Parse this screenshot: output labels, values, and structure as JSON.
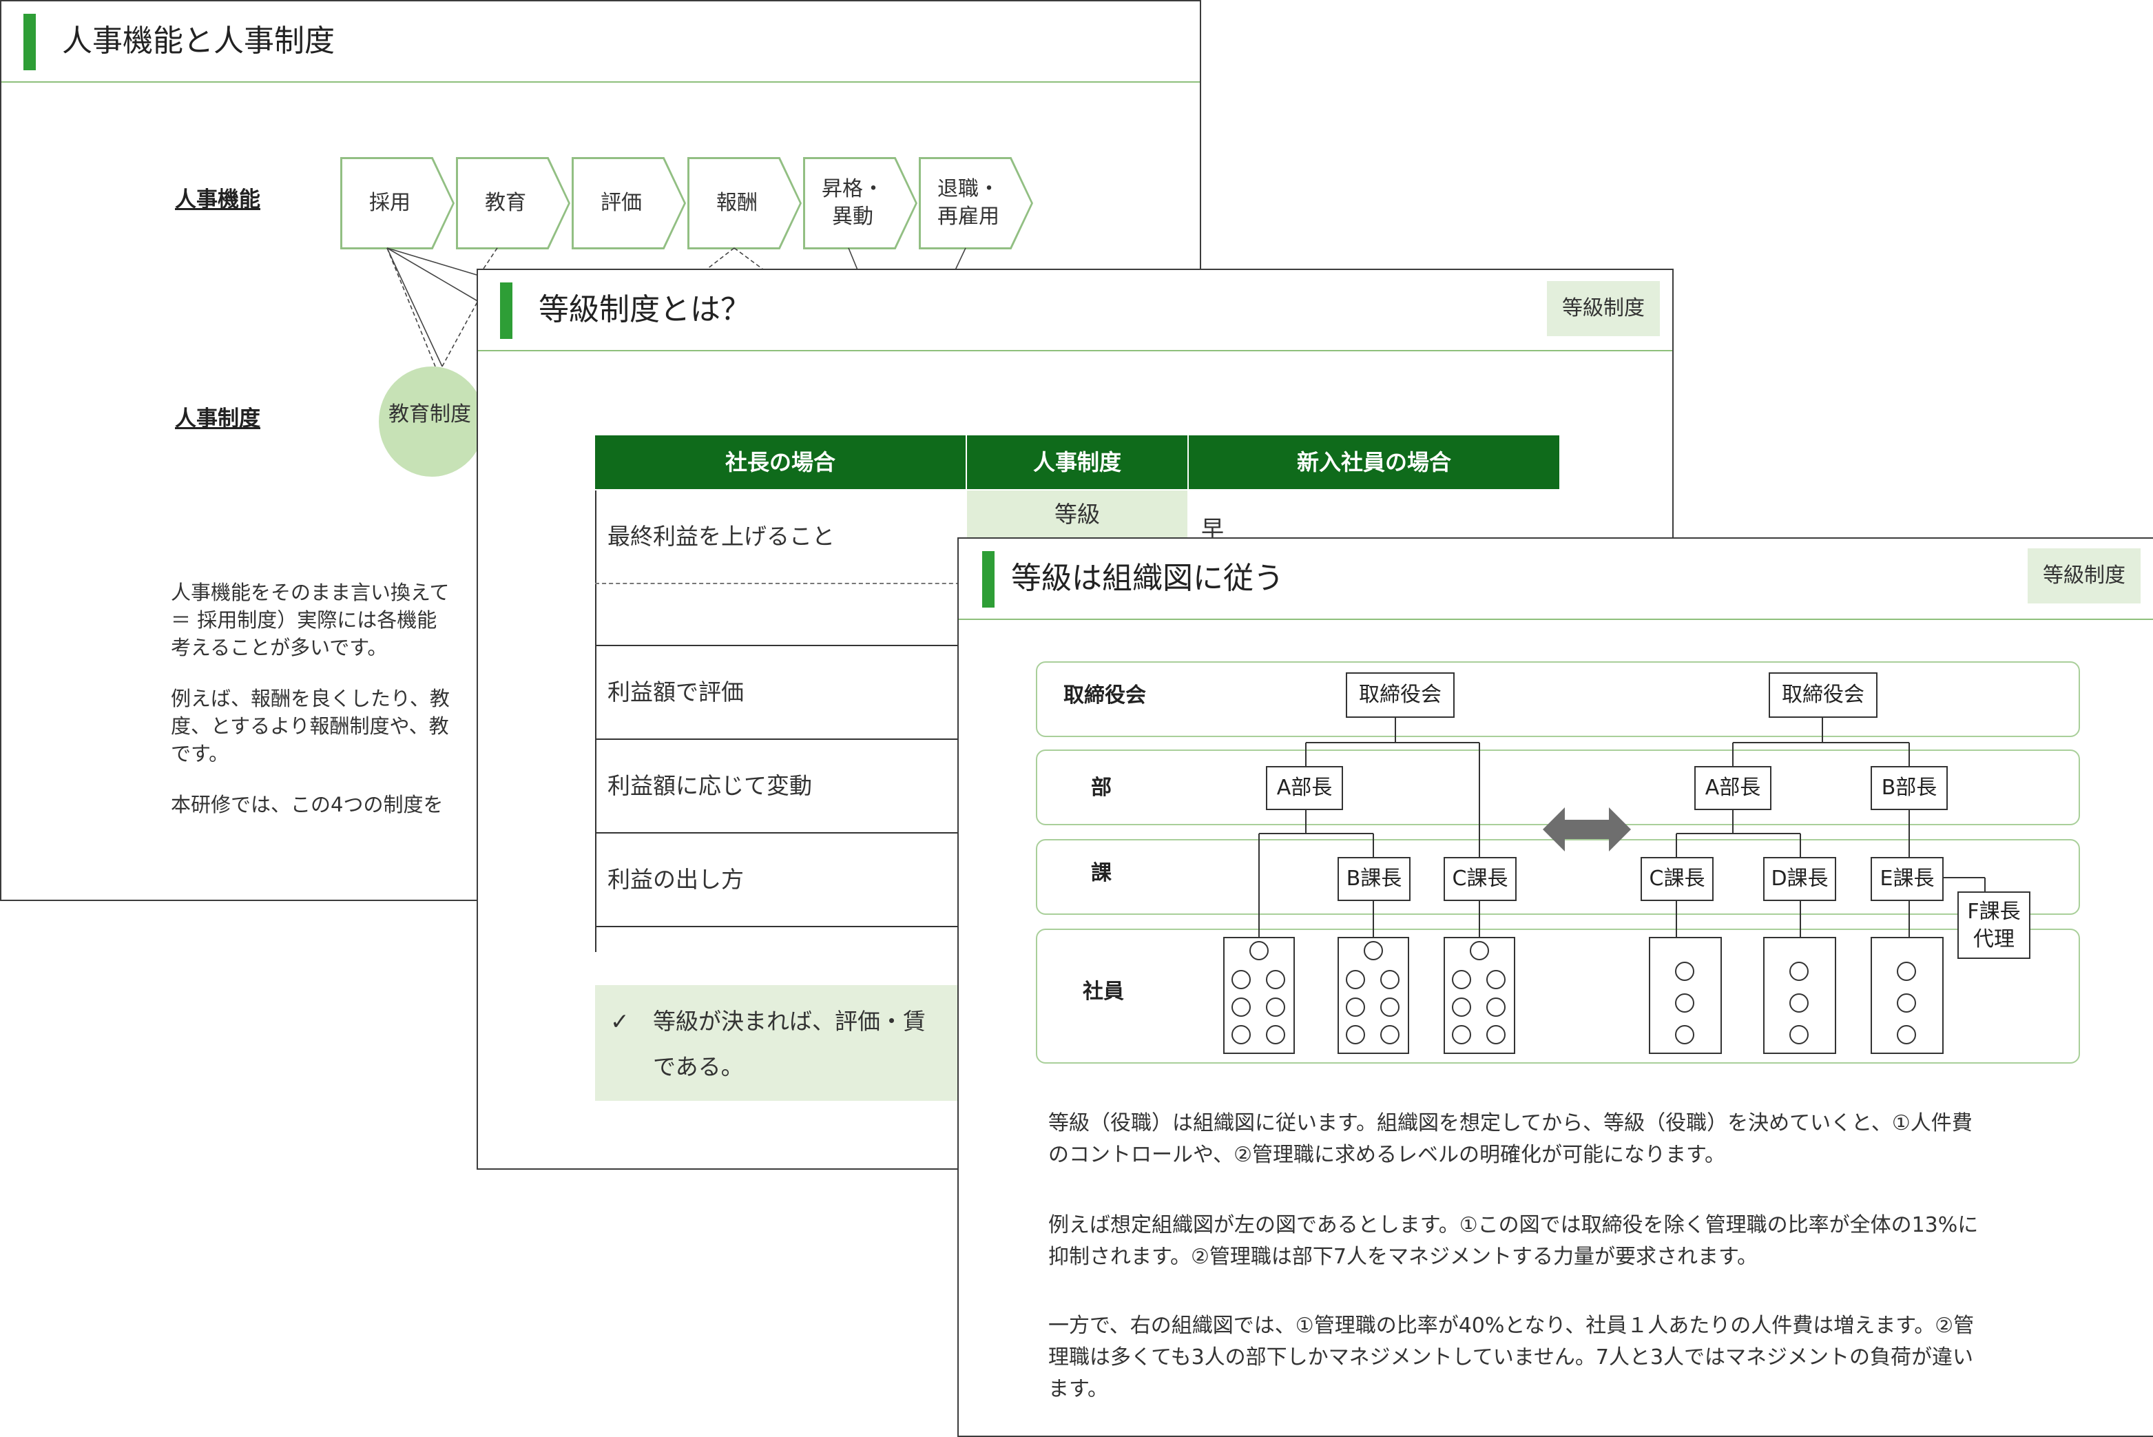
{
  "slide1": {
    "title": "人事機能と人事制度",
    "row_functions": "人事機能",
    "row_systems": "人事制度",
    "functions": [
      "採用",
      "教育",
      "評価",
      "報酬",
      "昇格・\n異動",
      "退職・\n再雇用"
    ],
    "system_circle": "教育制度",
    "para1": "人事機能をそのまま言い換えて\n＝ 採用制度）実際には各機能\n考えることが多いです。",
    "para2": "例えば、報酬を良くしたり、教\n度、とするより報酬制度や、教\nです。",
    "para3": "本研修では、この4つの制度を"
  },
  "slide2": {
    "title": "等級制度とは？",
    "tag": "等級制度",
    "headers": [
      "社長の場合",
      "人事制度",
      "新入社員の場合"
    ],
    "rows": [
      "最終利益を上げること",
      "",
      "利益額で評価",
      "利益額に応じて変動",
      "利益の出し方"
    ],
    "mid_cell": "等級",
    "right_cell": "早く業務を覚えること",
    "check": "✓",
    "callout_line1": "等級が決まれば、評価・賃",
    "callout_line2": "である。"
  },
  "slide3": {
    "title": "等級は組織図に従う",
    "tag": "等級制度",
    "lanes": [
      "取締役会",
      "部",
      "課",
      "社員"
    ],
    "left_chart": {
      "board": "取締役会",
      "dept": "A部長",
      "sections": [
        "B課長",
        "C課長"
      ]
    },
    "right_chart": {
      "board": "取締役会",
      "depts": [
        "A部長",
        "B部長"
      ],
      "sections": [
        "C課長",
        "D課長",
        "E課長"
      ],
      "deputy": "F課長\n代理"
    },
    "para1": "等級（役職）は組織図に従います。組織図を想定してから、等級（役職）を決めていくと、①人件費\nのコントロールや、②管理職に求めるレベルの明確化が可能になります。",
    "para2": "例えば想定組織図が左の図であるとします。①この図では取締役を除く管理職の比率が全体の13%に\n抑制されます。②管理職は部下7人をマネジメントする力量が要求されます。",
    "para3": "一方で、右の組織図では、①管理職の比率が40%となり、社員１人あたりの人件費は増えます。②管\n理職は多くても3人の部下しかマネジメントしていません。7人と3人ではマネジメントの負荷が違い\nます。"
  },
  "colors": {
    "accent": "#2e9e36",
    "header_dark": "#0f6b1b",
    "light_green": "#e4efdc",
    "chevron_border": "#92bf83"
  }
}
